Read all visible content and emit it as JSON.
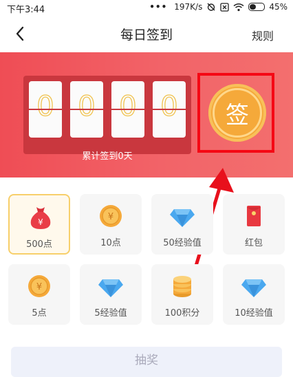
{
  "status_bar": {
    "time": "下午3:44",
    "dots": "•••",
    "network_speed": "197K/s",
    "battery": "45%"
  },
  "header": {
    "title": "每日签到",
    "rules_label": "规则"
  },
  "banner": {
    "digits": [
      "0",
      "0",
      "0",
      "0"
    ],
    "caption": "累计签到0天",
    "sign_label": "签"
  },
  "prizes": [
    {
      "label": "500点",
      "icon": "money-bag-icon",
      "selected": true
    },
    {
      "label": "10点",
      "icon": "coin-icon",
      "selected": false
    },
    {
      "label": "50经验值",
      "icon": "diamond-icon",
      "selected": false
    },
    {
      "label": "红包",
      "icon": "red-envelope-icon",
      "selected": false
    },
    {
      "label": "5点",
      "icon": "coin-icon",
      "selected": false
    },
    {
      "label": "5经验值",
      "icon": "diamond-icon",
      "selected": false
    },
    {
      "label": "100积分",
      "icon": "coin-stack-icon",
      "selected": false
    },
    {
      "label": "10经验值",
      "icon": "diamond-icon",
      "selected": false
    }
  ],
  "draw_button": {
    "label": "抽奖"
  },
  "colors": {
    "banner": "#ef4d55",
    "highlight": "#f50814",
    "coin": "#f5a93a"
  }
}
